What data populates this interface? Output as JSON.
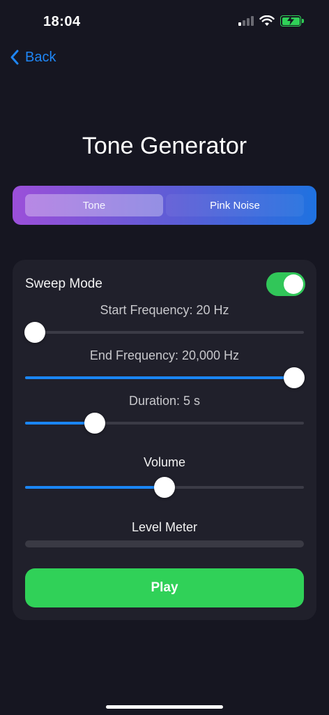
{
  "status_bar": {
    "time": "18:04",
    "signal_bars_active": 1,
    "signal_bars_total": 4,
    "battery_charging": true,
    "battery_color": "#30d158"
  },
  "nav": {
    "back_label": "Back",
    "back_icon": "chevron-left-icon"
  },
  "title": "Tone Generator",
  "mode_selector": {
    "options": [
      "Tone",
      "Pink Noise"
    ],
    "selected": "Tone"
  },
  "controls": {
    "sweep_mode": {
      "label": "Sweep Mode",
      "enabled": true
    },
    "start_frequency": {
      "label": "Start Frequency: 20 Hz",
      "value_fraction": 0.0
    },
    "end_frequency": {
      "label": "End Frequency: 20,000 Hz",
      "value_fraction": 1.0
    },
    "duration": {
      "label": "Duration: 5 s",
      "value_fraction": 0.23
    },
    "volume": {
      "label": "Volume",
      "value_fraction": 0.5
    },
    "level_meter": {
      "label": "Level Meter",
      "level_fraction": 0.0
    },
    "play_label": "Play"
  },
  "colors": {
    "background": "#161621",
    "card": "#20202b",
    "accent_blue": "#1a86f5",
    "accent_green": "#30d158",
    "gradient_start": "#9b4fd9",
    "gradient_end": "#1f72e0"
  }
}
